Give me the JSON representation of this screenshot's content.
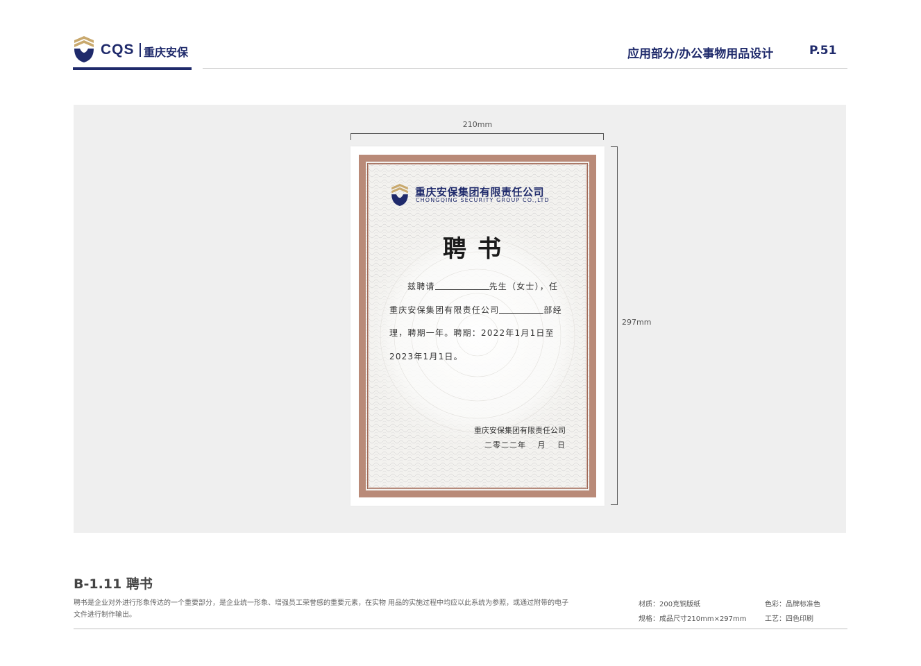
{
  "header": {
    "brand_abbr": "CQS",
    "brand_cn": "重庆安保",
    "section": "应用部分/办公事物用品设计",
    "page": "P.51"
  },
  "dimensions": {
    "width_label": "210mm",
    "height_label": "297mm"
  },
  "certificate": {
    "company_cn": "重庆安保集团有限责任公司",
    "company_en": "CHONGQING SECURITY GROUP CO.,LTD",
    "title": "聘书",
    "line1_a": "兹聘请",
    "line1_b": "先生（女士），任",
    "line2_a": "重庆安保集团有限责任公司",
    "line2_b": "部经",
    "line3": "理，聘期一年。聘期：2022年1月1日至",
    "line4": "2023年1月1日。",
    "signature_company": "重庆安保集团有限责任公司",
    "signature_date": "二零二二年　 月　 日"
  },
  "footer": {
    "section_title": "B-1.11 聘书",
    "description": "聘书是企业对外进行形象传达的一个重要部分，是企业统一形象、增强员工荣誉感的重要元素，在实物  用品的实施过程中均应以此系统为参照，或通过附带的电子文件进行制作输出。",
    "material": "材质：200克铜版纸",
    "color": "色彩：品牌标准色",
    "size": "规格：成品尺寸210mm×297mm",
    "process": "工艺：四色印刷"
  },
  "colors": {
    "brand_navy": "#1f2a6b",
    "brand_gold": "#c9a96e",
    "border_brown": "#b98a78",
    "panel_gray": "#efefef"
  }
}
